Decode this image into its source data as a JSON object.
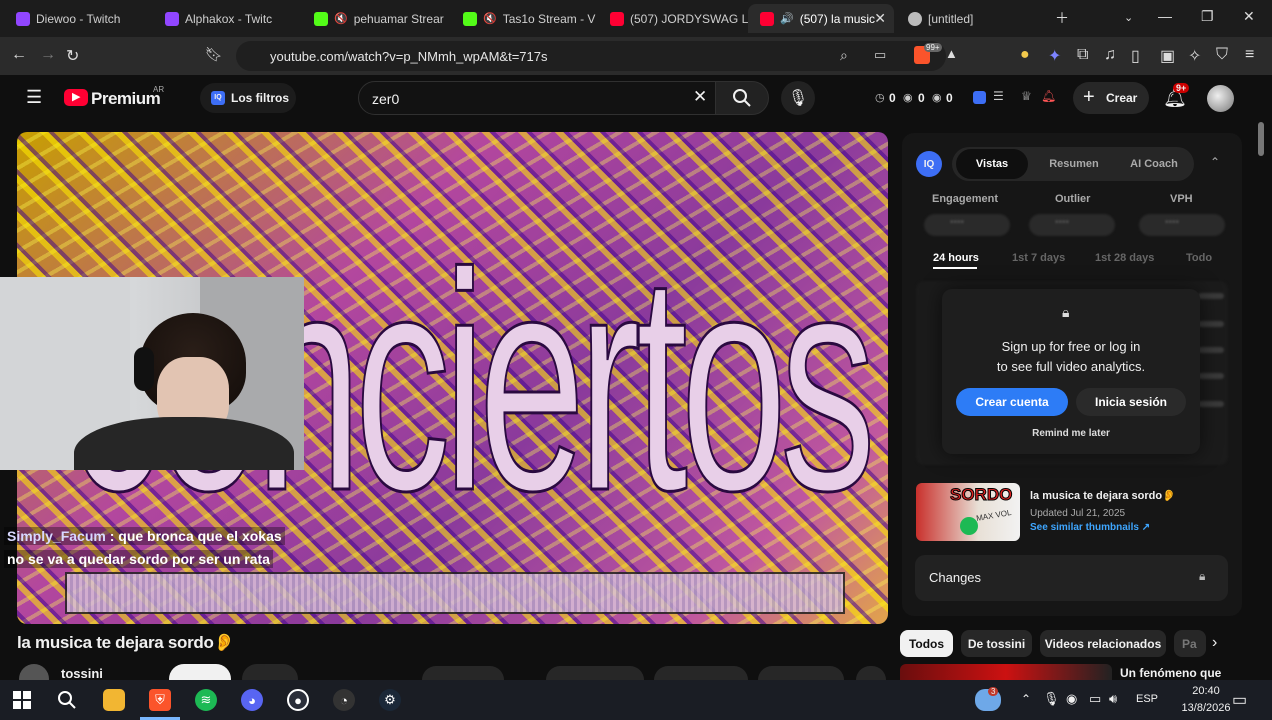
{
  "tabs": [
    {
      "label": "Diewoo - Twitch",
      "icon": "twitch-icon",
      "color": "#9146ff"
    },
    {
      "label": "Alphakox - Twitc",
      "icon": "twitch-icon",
      "color": "#9146ff"
    },
    {
      "label": "pehuamar Strear",
      "icon": "kick-icon",
      "color": "#53fc18"
    },
    {
      "label": "Tas1o Stream - V",
      "icon": "kick-icon",
      "color": "#53fc18"
    },
    {
      "label": "(507) JORDYSWAG L",
      "icon": "youtube-icon",
      "color": "#ff0033"
    },
    {
      "label": "(507) la music",
      "icon": "youtube-icon",
      "color": "#ff0033"
    },
    {
      "label": "[untitled]",
      "icon": "page-icon",
      "color": "#bbbbbb"
    }
  ],
  "address": {
    "url": "youtube.com/watch?v=p_NMmh_wpAM&t=717s",
    "brave_badge": "99+"
  },
  "yt_header": {
    "brand": "Premium",
    "region": "AR",
    "filters_label": "Los filtros",
    "search_value": "zer0",
    "stats": [
      "0",
      "0",
      "0"
    ],
    "create_label": "Crear",
    "notif_badge": "9+"
  },
  "video": {
    "overlay_text": "conciertos",
    "chat_user": "Simply_Facum",
    "chat_line1": ": que bronca que el xokas",
    "chat_line2": "no se va a quedar sordo por ser un rata"
  },
  "below_video": {
    "title": "la musica te dejara sordo👂",
    "channel": "tossini"
  },
  "panel": {
    "tabs": [
      "Vistas",
      "Resumen",
      "AI Coach"
    ],
    "metrics": [
      "Engagement",
      "Outlier",
      "VPH"
    ],
    "metric_values": [
      "••••",
      "••••",
      "••••"
    ],
    "ranges": [
      "24 hours",
      "1st 7 days",
      "1st 28 days",
      "Todo"
    ],
    "popup_line1": "Sign up for free or log in",
    "popup_line2": "to see full video analytics.",
    "create_account": "Crear cuenta",
    "login": "Inicia sesión",
    "remind": "Remind me later",
    "thumb_title": "la musica te dejara sordo👂",
    "thumb_updated": "Updated Jul 21, 2025",
    "thumb_link": "See similar thumbnails",
    "thumb_text": "SORDO",
    "thumb_text2": "MAX VOL",
    "changes": "Changes"
  },
  "chips": [
    "Todos",
    "De tossini",
    "Videos relacionados",
    "Pa"
  ],
  "related_title": "Un fenómeno que",
  "taskbar": {
    "lang": "ESP",
    "time": "20:40",
    "date": "13/8/2026",
    "weather_badge": "3"
  }
}
